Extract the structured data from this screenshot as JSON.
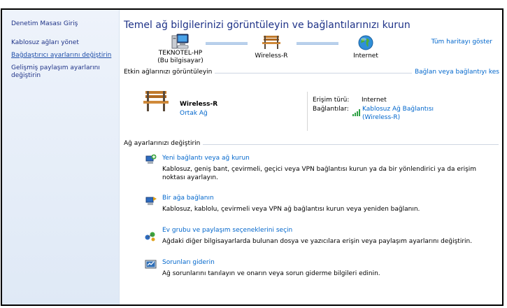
{
  "sidebar": {
    "items": [
      {
        "label": "Denetim Masası Giriş"
      },
      {
        "label": "Kablosuz ağları yönet"
      },
      {
        "label": "Bağdaştırıcı ayarlarını değiştirin"
      },
      {
        "label": "Gelişmiş paylaşım ayarlarını değiştirin"
      }
    ]
  },
  "main": {
    "title": "Temel ağ bilgilerinizi görüntüleyin ve bağlantılarınızı kurun",
    "full_map_link": "Tüm haritayı göster",
    "map": {
      "computer_name": "TEKNOTEL-HP",
      "computer_sub": "(Bu bilgisayar)",
      "network_name": "Wireless-R",
      "internet_label": "Internet"
    },
    "active_section": "Etkin ağlarınızı görüntüleyin",
    "connect_link": "Bağlan veya bağlantıyı kes",
    "network": {
      "name": "Wireless-R",
      "type": "Ortak Ağ",
      "access_label": "Erişim türü:",
      "access_value": "Internet",
      "connections_label": "Bağlantılar:",
      "connection_link_1": "Kablosuz Ağ Bağlantısı",
      "connection_link_2": "(Wireless-R)"
    },
    "settings_section": "Ağ ayarlarınızı değiştirin",
    "tasks": [
      {
        "title": "Yeni bağlantı veya ağ kurun",
        "desc_1": "Kablosuz, geniş bant, çevirmeli, geçici veya VPN bağlantısı kurun ya da bir yönlendirici ya da erişim",
        "desc_2": "noktası ayarlayın."
      },
      {
        "title": "Bir ağa bağlanın",
        "desc_1": "Kablosuz, kablolu, çevirmeli veya VPN ağ bağlantısı kurun veya yeniden bağlanın."
      },
      {
        "title": "Ev grubu ve paylaşım seçeneklerini seçin",
        "desc_1": "Ağdaki diğer bilgisayarlarda bulunan dosya ve yazıcılara erişin veya paylaşım ayarlarını değiştirin."
      },
      {
        "title": "Sorunları giderin",
        "desc_1": "Ağ sorunlarını tanılayın ve onarın veya sorun giderme bilgileri edinin."
      }
    ]
  }
}
